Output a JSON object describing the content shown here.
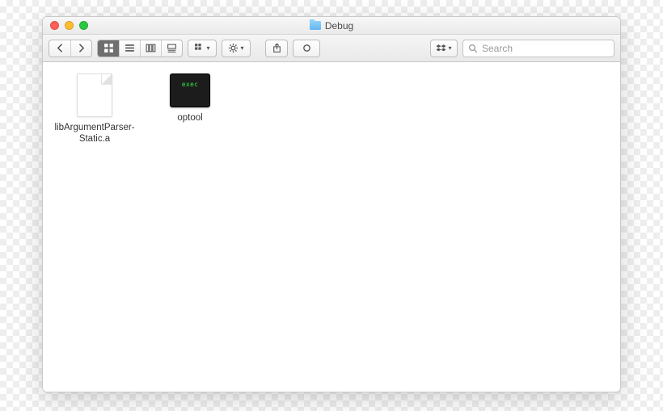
{
  "window": {
    "title": "Debug"
  },
  "toolbar": {
    "search_placeholder": "Search"
  },
  "files": [
    {
      "name": "libArgumentParser-Static.a",
      "kind": "archive"
    },
    {
      "name": "optool",
      "kind": "exec",
      "exec_label": "exec"
    }
  ]
}
